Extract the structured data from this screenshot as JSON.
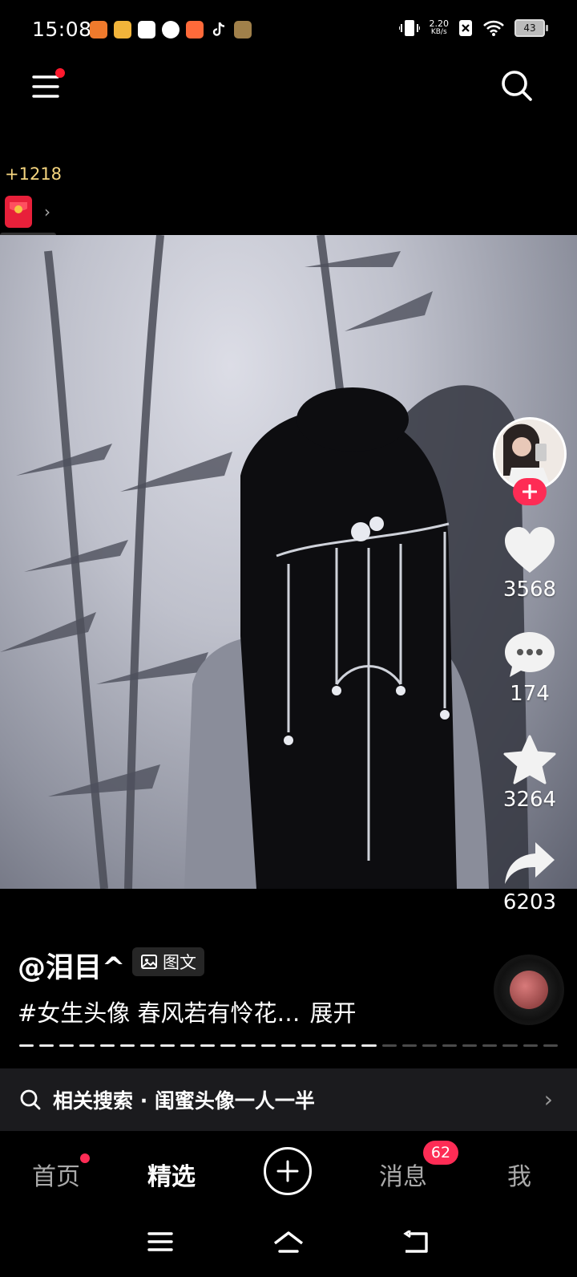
{
  "status_bar": {
    "time": "15:08",
    "net_speed_value": "2.20",
    "net_speed_unit": "KB/s",
    "battery": "43"
  },
  "top_nav": {
    "coin_count": "+1218"
  },
  "post": {
    "username": "@泪目^",
    "type_badge": "图文",
    "caption": "#女生头像 春风若有怜花…",
    "expand_label": "展开",
    "like_count": "3568",
    "comment_count": "174",
    "favorite_count": "3264",
    "share_count": "6203",
    "progress_segments_total": 27,
    "progress_segments_viewed": 18
  },
  "related_search": {
    "label": "相关搜索 · 闺蜜头像一人一半"
  },
  "tabs": {
    "home": "首页",
    "featured": "精选",
    "messages": "消息",
    "messages_badge": "62",
    "me": "我"
  },
  "colors": {
    "accent": "#fe2c55",
    "coin": "#f5d57f",
    "background": "#000000"
  }
}
